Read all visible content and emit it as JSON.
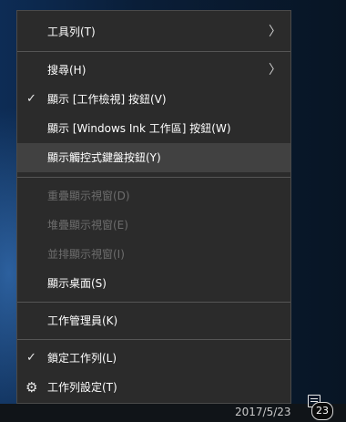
{
  "menu": {
    "items": [
      {
        "label": "工具列(T)",
        "has_submenu": true
      },
      {
        "label": "搜尋(H)",
        "has_submenu": true
      },
      {
        "label": "顯示 [工作檢視] 按鈕(V)",
        "checked": true
      },
      {
        "label": "顯示 [Windows Ink 工作區] 按鈕(W)"
      },
      {
        "label": "顯示觸控式鍵盤按鈕(Y)",
        "highlighted": true
      },
      {
        "label": "重疊顯示視窗(D)",
        "disabled": true
      },
      {
        "label": "堆疊顯示視窗(E)",
        "disabled": true
      },
      {
        "label": "並排顯示視窗(I)",
        "disabled": true
      },
      {
        "label": "顯示桌面(S)"
      },
      {
        "label": "工作管理員(K)"
      },
      {
        "label": "鎖定工作列(L)",
        "checked": true
      },
      {
        "label": "工作列設定(T)",
        "icon": "gear-icon"
      }
    ],
    "check_glyph": "✓",
    "arrow_glyph": "〉",
    "gear_glyph": "⚙"
  },
  "taskbar": {
    "date": "2017/5/23",
    "notification_count": "23"
  },
  "colors": {
    "menu_bg": "#2b2b2b",
    "highlight_bg": "#414141",
    "disabled_text": "#6d6d6d"
  }
}
